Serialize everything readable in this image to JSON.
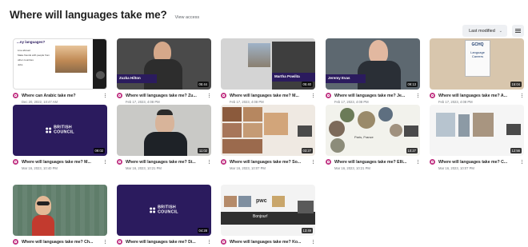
{
  "header": {
    "title": "Where will languages take me?",
    "view_access": "View access"
  },
  "toolbar": {
    "sort_label": "Last modified",
    "list_view_icon": "list-view-icon"
  },
  "colors": {
    "accent": "#c13584",
    "purple": "#2b1b5e"
  },
  "cards": [
    {
      "title": "Where can Arabic take me?",
      "date": "Dec 20, 2022, 10:47 AM",
      "duration": ""
    },
    {
      "title": "Where will languages take me? Zu...",
      "date": "Feb 17, 2023, 4:08 PM",
      "duration": "05:44"
    },
    {
      "title": "Where will languages take me? M...",
      "date": "Feb 17, 2023, 4:08 PM",
      "duration": "05:40"
    },
    {
      "title": "Where will languages take me? Je...",
      "date": "Feb 17, 2023, 4:08 PM",
      "duration": "09:13"
    },
    {
      "title": "Where will languages take me? A...",
      "date": "Feb 17, 2023, 4:08 PM",
      "duration": "15:04"
    },
    {
      "title": "Where will languages take me? M...",
      "date": "Mar 16, 2023, 10:40 PM",
      "duration": "09:02"
    },
    {
      "title": "Where will languages take me? St...",
      "date": "Mar 16, 2023, 10:21 PM",
      "duration": "11:02"
    },
    {
      "title": "Where will languages take me? So...",
      "date": "Mar 16, 2023, 10:07 PM",
      "duration": "03:27"
    },
    {
      "title": "Where will languages take me? Elli...",
      "date": "Mar 16, 2023, 10:21 PM",
      "duration": "10:27"
    },
    {
      "title": "Where will languages take me? C...",
      "date": "Mar 16, 2023, 10:07 PM",
      "duration": "12:56"
    },
    {
      "title": "Where will languages take me? Ch...",
      "date": "",
      "duration": ""
    },
    {
      "title": "Where will languages take me? Di...",
      "date": "",
      "duration": "04:28"
    },
    {
      "title": "Where will languages take me? Ko...",
      "date": "",
      "duration": "13:49"
    }
  ],
  "thumb_text": {
    "british": "BRITISH",
    "council": "COUNCIL",
    "zuzka_name": "Zuzka Hilton",
    "martha_name": "Martha Powlita",
    "jeremy_name": "Jeremy Evas",
    "gchq": "GCHQ",
    "language": "Language",
    "careers": "Careers",
    "paris": "Paris, France",
    "bonjour": "Bonjour!",
    "pwc": "pwc",
    "arabic_title": "...ny languages?",
    "arabic_lines": [
      "Live abroad",
      "Make friends with people from other countries",
      "Jobs"
    ]
  }
}
